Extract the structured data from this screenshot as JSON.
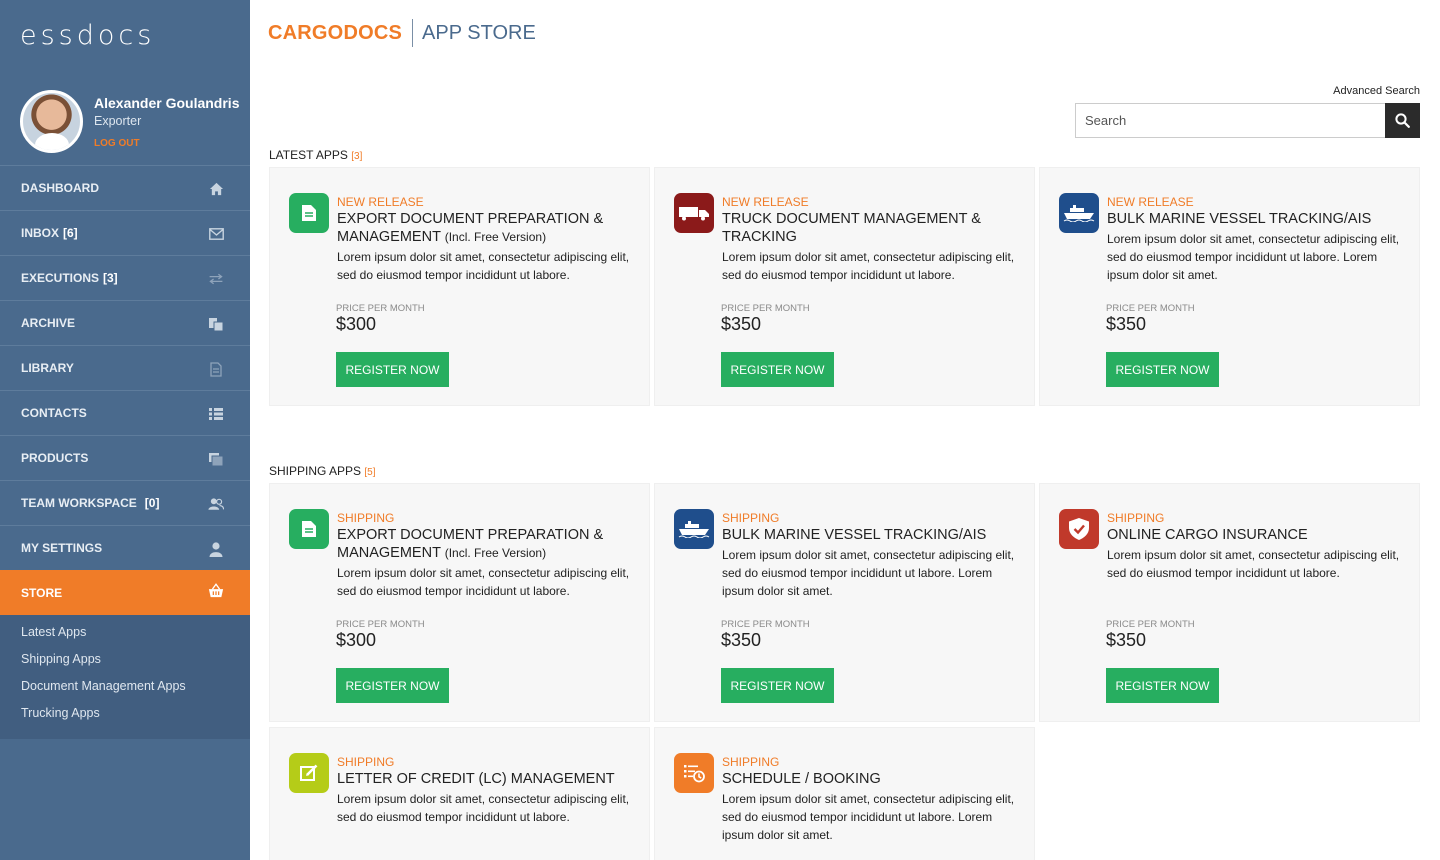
{
  "app": {
    "logo": "essdocs",
    "brand": "CARGODOCS",
    "title": "APP STORE"
  },
  "colors": {
    "accent": "#f07c28",
    "sidebar": "#4a6a8d",
    "register": "#27ae60"
  },
  "user": {
    "name": "Alexander Goulandris",
    "role": "Exporter",
    "logout": "LOG OUT"
  },
  "nav": [
    {
      "label": "DASHBOARD",
      "count": "",
      "icon": "home-icon"
    },
    {
      "label": "INBOX",
      "count": "[6]",
      "icon": "envelope-icon"
    },
    {
      "label": "EXECUTIONS",
      "count": "[3]",
      "icon": "arrows-exchange-icon"
    },
    {
      "label": "ARCHIVE",
      "count": "",
      "icon": "files-icon"
    },
    {
      "label": "LIBRARY",
      "count": "",
      "icon": "document-icon"
    },
    {
      "label": "CONTACTS",
      "count": "",
      "icon": "list-icon"
    },
    {
      "label": "PRODUCTS",
      "count": "",
      "icon": "stack-icon"
    },
    {
      "label": "TEAM WORKSPACE",
      "count": "[0]",
      "icon": "users-icon"
    },
    {
      "label": "MY SETTINGS",
      "count": "",
      "icon": "user-icon"
    },
    {
      "label": "STORE",
      "count": "",
      "icon": "basket-icon"
    }
  ],
  "subnav": [
    "Latest Apps",
    "Shipping Apps",
    "Document Management Apps",
    "Trucking Apps"
  ],
  "search": {
    "advanced": "Advanced Search",
    "placeholder": "Search"
  },
  "sections": {
    "latest": {
      "title": "LATEST APPS",
      "count": "[3]"
    },
    "shipping": {
      "title": "SHIPPING APPS",
      "count": "[5]"
    }
  },
  "common": {
    "price_label": "PRICE PER MONTH",
    "register": "REGISTER NOW"
  },
  "latest_cards": [
    {
      "tag": "NEW RELEASE",
      "title": "EXPORT DOCUMENT PREPARATION & MANAGEMENT",
      "title_small": "(Incl. Free Version)",
      "desc": "Lorem ipsum dolor sit amet, consectetur adipiscing elit, sed do eiusmod tempor incididunt ut labore.",
      "price": "$300",
      "icon": "document-icon",
      "icon_color": "#27ae60"
    },
    {
      "tag": "NEW RELEASE",
      "title": "TRUCK DOCUMENT MANAGEMENT  & TRACKING",
      "title_small": "",
      "desc": "Lorem ipsum dolor sit amet, consectetur adipiscing elit, sed do eiusmod tempor incididunt ut labore.",
      "price": "$350",
      "icon": "truck-icon",
      "icon_color": "#8b1a1a"
    },
    {
      "tag": "NEW RELEASE",
      "title": "BULK MARINE VESSEL TRACKING/AIS",
      "title_small": "",
      "desc": "Lorem ipsum dolor sit amet, consectetur adipiscing elit, sed do eiusmod tempor incididunt ut labore. Lorem ipsum dolor sit amet.",
      "price": "$350",
      "icon": "ship-icon",
      "icon_color": "#1f4e8c"
    }
  ],
  "shipping_cards": [
    {
      "tag": "SHIPPING",
      "title": "EXPORT DOCUMENT PREPARATION & MANAGEMENT",
      "title_small": "(Incl. Free Version)",
      "desc": "Lorem ipsum dolor sit amet, consectetur adipiscing elit, sed do eiusmod tempor incididunt ut labore.",
      "price": "$300",
      "icon": "document-icon",
      "icon_color": "#27ae60"
    },
    {
      "tag": "SHIPPING",
      "title": "BULK MARINE VESSEL TRACKING/AIS",
      "title_small": "",
      "desc": "Lorem ipsum dolor sit amet, consectetur adipiscing elit, sed do eiusmod tempor incididunt ut labore. Lorem ipsum dolor sit amet.",
      "price": "$350",
      "icon": "ship-icon",
      "icon_color": "#1f4e8c"
    },
    {
      "tag": "SHIPPING",
      "title": "ONLINE CARGO INSURANCE",
      "title_small": "",
      "desc": "Lorem ipsum dolor sit amet, consectetur adipiscing elit, sed do eiusmod tempor incididunt ut labore.",
      "price": "$350",
      "icon": "shield-icon",
      "icon_color": "#c0392b"
    },
    {
      "tag": "SHIPPING",
      "title": "LETTER OF CREDIT (LC) MANAGEMENT",
      "title_small": "",
      "desc": "Lorem ipsum dolor sit amet, consectetur adipiscing elit, sed do eiusmod tempor incididunt ut labore.",
      "price": "",
      "icon": "edit-icon",
      "icon_color": "#b5cc18"
    },
    {
      "tag": "SHIPPING",
      "title": "SCHEDULE / BOOKING",
      "title_small": "",
      "desc": "Lorem ipsum dolor sit amet, consectetur adipiscing elit, sed do eiusmod tempor incididunt ut labore. Lorem ipsum dolor sit amet.",
      "price": "",
      "icon": "schedule-icon",
      "icon_color": "#f07c28"
    }
  ]
}
